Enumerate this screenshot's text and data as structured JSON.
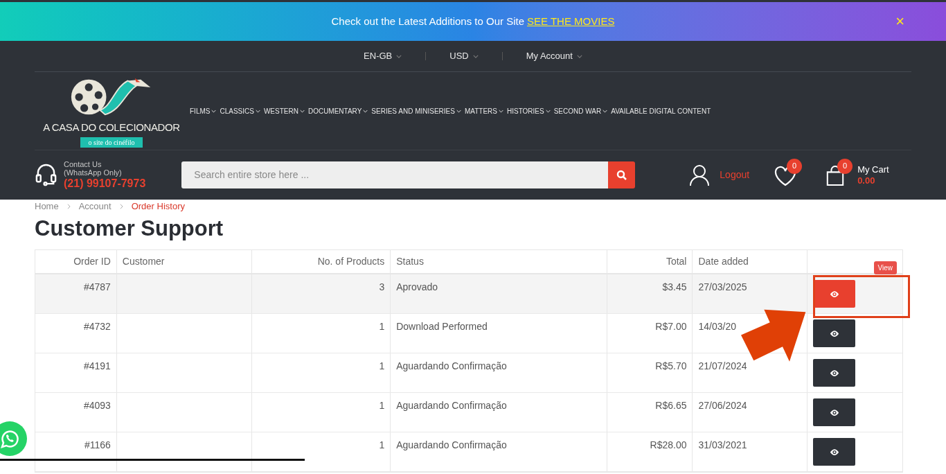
{
  "announcement": {
    "text": "Check out the Latest Additions to Our Site",
    "link": "SEE THE MOVIES",
    "close": "×"
  },
  "top_bar": [
    {
      "label": "EN-GB",
      "dropdown": true
    },
    {
      "label": "USD",
      "dropdown": true
    },
    {
      "label": "My Account",
      "dropdown": true
    }
  ],
  "logo": {
    "name": "A CASA DO COLECIONADOR",
    "tagline": "o site do cinéfilo"
  },
  "nav": [
    {
      "label": "FILMS",
      "dropdown": true
    },
    {
      "label": "CLASSICS",
      "dropdown": true
    },
    {
      "label": "WESTERN",
      "dropdown": true
    },
    {
      "label": "DOCUMENTARY",
      "dropdown": true
    },
    {
      "label": "SERIES AND MINISERIES",
      "dropdown": true
    },
    {
      "label": "MATTERS",
      "dropdown": true
    },
    {
      "label": "HISTORIES",
      "dropdown": true
    },
    {
      "label": "SECOND WAR",
      "dropdown": true
    },
    {
      "label": "AVAILABLE DIGITAL CONTENT",
      "dropdown": false
    }
  ],
  "contact": {
    "label": "Contact Us",
    "note": "(WhatsApp Only)",
    "phone": "(21) 99107-7973"
  },
  "search": {
    "placeholder": "Search entire store here ..."
  },
  "account": {
    "logout": "Logout",
    "wishlist_count": "0",
    "cart_count": "0",
    "cart_label": "My Cart",
    "cart_total": "0.00"
  },
  "breadcrumb": [
    {
      "label": "Home",
      "current": false
    },
    {
      "label": "Account",
      "current": false
    },
    {
      "label": "Order History",
      "current": true
    }
  ],
  "title": "Customer Support",
  "table": {
    "columns": [
      "Order ID",
      "Customer",
      "No. of Products",
      "Status",
      "Total",
      "Date added"
    ],
    "tooltip": "View",
    "rows": [
      {
        "order_id": "#4787",
        "products": "3",
        "status": "Aprovado",
        "total": "$3.45",
        "date": "27/03/2025",
        "selected": true
      },
      {
        "order_id": "#4732",
        "products": "1",
        "status": "Download Performed",
        "total": "R$7.00",
        "date": "14/03/20",
        "selected": false
      },
      {
        "order_id": "#4191",
        "products": "1",
        "status": "Aguardando Confirmação",
        "total": "R$5.70",
        "date": "21/07/2024",
        "selected": false
      },
      {
        "order_id": "#4093",
        "products": "1",
        "status": "Aguardando Confirmação",
        "total": "R$6.65",
        "date": "27/06/2024",
        "selected": false
      },
      {
        "order_id": "#1166",
        "products": "1",
        "status": "Aguardando Confirmação",
        "total": "R$28.00",
        "date": "31/03/2021",
        "selected": false
      }
    ]
  }
}
